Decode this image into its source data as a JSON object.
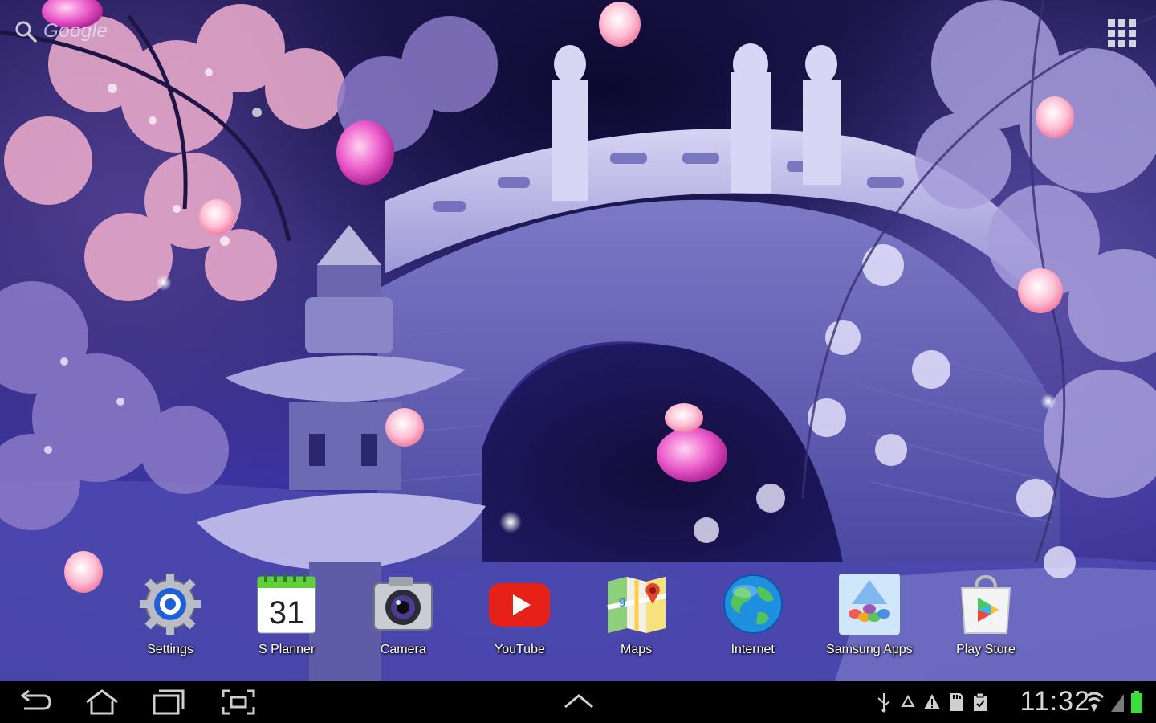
{
  "search": {
    "label": "Google"
  },
  "dock": {
    "apps": [
      {
        "label": "Settings",
        "icon": "settings-icon"
      },
      {
        "label": "S Planner",
        "icon": "calendar-icon",
        "date": "31"
      },
      {
        "label": "Camera",
        "icon": "camera-icon"
      },
      {
        "label": "YouTube",
        "icon": "youtube-icon"
      },
      {
        "label": "Maps",
        "icon": "maps-icon"
      },
      {
        "label": "Internet",
        "icon": "globe-icon"
      },
      {
        "label": "Samsung Apps",
        "icon": "samsung-apps-icon"
      },
      {
        "label": "Play Store",
        "icon": "play-store-icon"
      }
    ]
  },
  "system_bar": {
    "time": "11:32",
    "nav": [
      "back-icon",
      "home-icon",
      "recent-apps-icon",
      "screenshot-icon",
      "up-chevron-icon"
    ],
    "tray": [
      "usb-icon",
      "recycle-icon",
      "warning-icon",
      "sd-card-icon",
      "clipboard-icon"
    ]
  },
  "colors": {
    "wallpaper_purple": "#3a32a0",
    "blossom_pink": "#e6a7c9",
    "magenta_petal": "#e353c3",
    "youtube_red": "#e62117",
    "battery_green": "#3ddc3d"
  }
}
